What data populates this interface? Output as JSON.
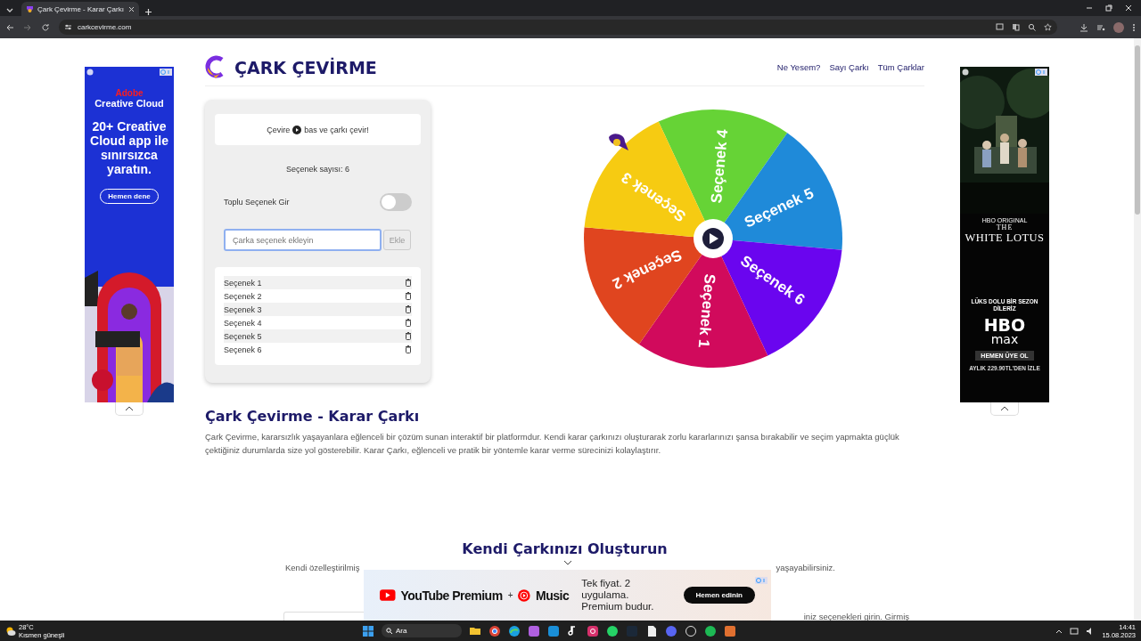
{
  "browser": {
    "tab_title": "Çark Çevirme - Karar Çarkı",
    "url": "carkcevirme.com"
  },
  "header": {
    "logo_text": "ÇARK ÇEVİRME",
    "nav": [
      "Ne Yesem?",
      "Sayı Çarkı",
      "Tüm Çarklar"
    ]
  },
  "panel": {
    "hint_before": "Çevire",
    "hint_after": "bas ve çarkı çevir!",
    "count": "Seçenek sayısı: 6",
    "bulk_toggle": {
      "label": "Toplu Seçenek Gir",
      "on": false
    },
    "input": {
      "placeholder": "Çarka seçenek ekleyin",
      "focused": true
    },
    "add_button": "Ekle",
    "options": [
      "Seçenek 1",
      "Seçenek 2",
      "Seçenek 3",
      "Seçenek 4",
      "Seçenek 5",
      "Seçenek 6"
    ]
  },
  "wheel": {
    "segments": [
      {
        "label": "Seçenek 4",
        "color": "#66d336"
      },
      {
        "label": "Seçenek 5",
        "color": "#1f8ad9"
      },
      {
        "label": "Seçenek 6",
        "color": "#6a05ef"
      },
      {
        "label": "Seçenek 1",
        "color": "#d10a5c"
      },
      {
        "label": "Seçenek 2",
        "color": "#e0451f"
      },
      {
        "label": "Seçenek 3",
        "color": "#f6cb12"
      }
    ]
  },
  "article": {
    "title": "Çark Çevirme - Karar Çarkı",
    "text": "Çark Çevirme, kararsızlık yaşayanlara eğlenceli bir çözüm sunan interaktif bir platformdur. Kendi karar çarkınızı oluşturarak zorlu kararlarınızı şansa bırakabilir ve seçim yapmakta güçlük çektiğiniz durumlarda size yol gösterebilir. Karar Çarkı, eğlenceli ve pratik bir yöntemle karar verme sürecinizi kolaylaştırır.",
    "subtitle": "Kendi Çarkınızı Oluşturun",
    "text_start": "Kendi özelleştirilmiş",
    "text_end": "yaşayabilirsiniz.",
    "next_fragment": "iniz seçenekleri girin. Girmiş"
  },
  "ads": [
    {
      "kind": "adobe",
      "brand": "Adobe",
      "product": "Creative Cloud",
      "headline": "20+ Creative Cloud app ile sınırsızca yaratın.",
      "button": "Hemen dene"
    },
    {
      "kind": "hbo",
      "label": "HBO ORIGINAL",
      "title_top": "THE",
      "title": "WHITE LOTUS",
      "tagline": "LÜKS DOLU BİR SEZON DİLERİZ",
      "logo_top": "HBO",
      "logo_bottom": "max",
      "button": "HEMEN ÜYE OL",
      "price": "AYLIK 229.90TL'DEN İZLE"
    }
  ],
  "bottom_ad": {
    "brand1": "YouTube Premium",
    "plus": "+",
    "brand2": "Music",
    "lines": [
      "Tek fiyat. 2 uygulama.",
      "Premium budur."
    ],
    "button": "Hemen edinin"
  },
  "taskbar": {
    "temp": "28°C",
    "weather": "Kısmen güneşli",
    "search_placeholder": "Ara",
    "time": "14:41",
    "date": "15.08.2023"
  }
}
